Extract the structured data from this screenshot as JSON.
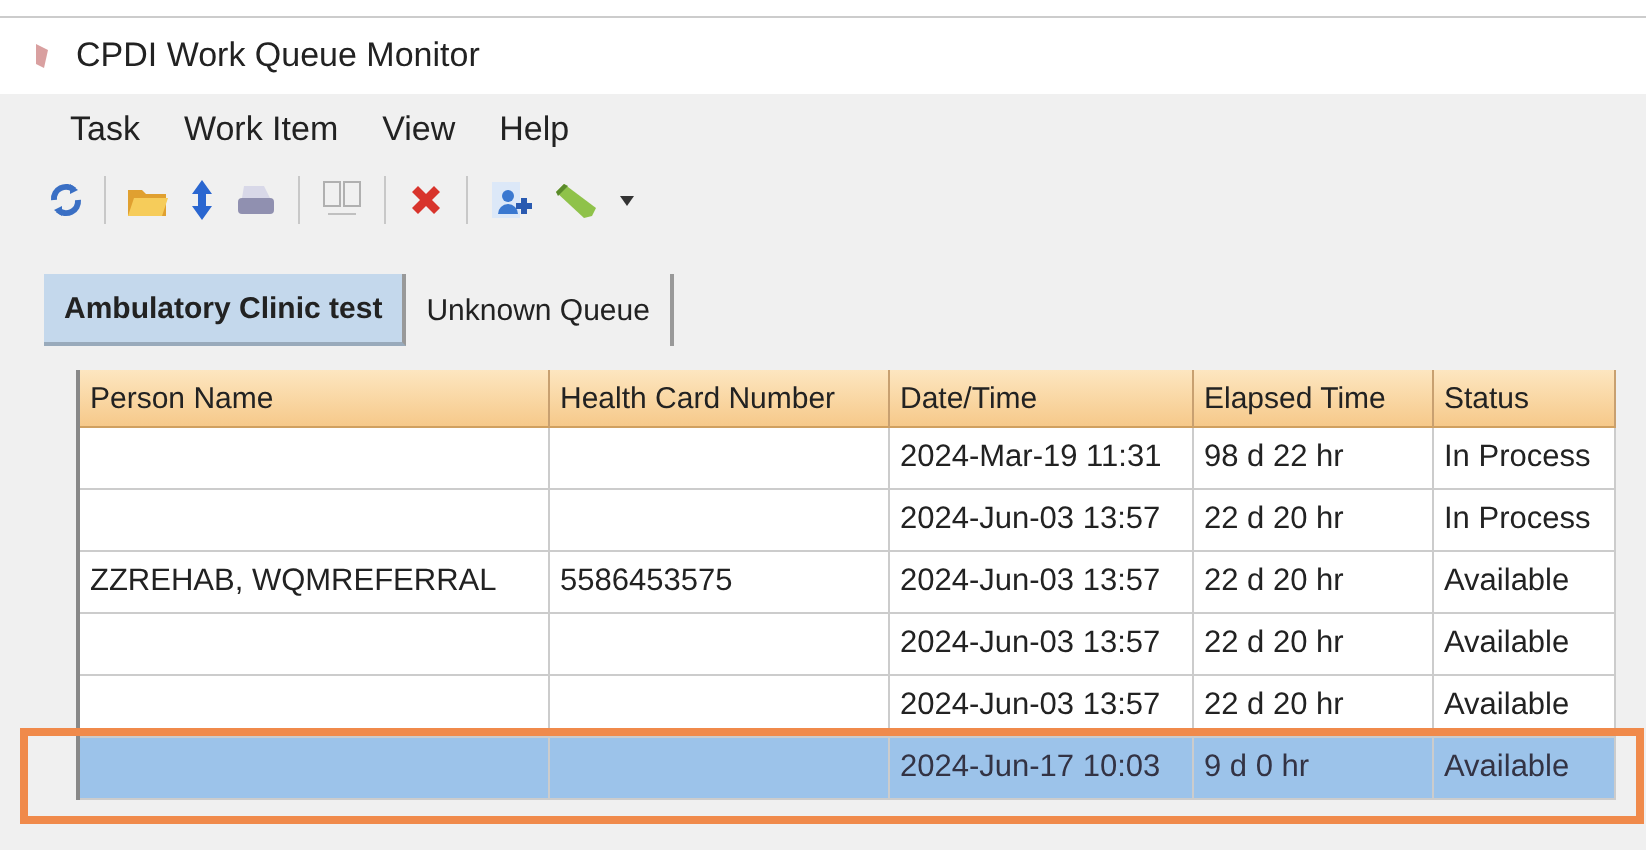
{
  "window": {
    "title": "CPDI Work Queue Monitor"
  },
  "menu": [
    "Task",
    "Work Item",
    "View",
    "Help"
  ],
  "tabs": [
    {
      "label": "Ambulatory Clinic test",
      "selected": true
    },
    {
      "label": "Unknown Queue",
      "selected": false
    }
  ],
  "table": {
    "columns": [
      "Person Name",
      "Health Card Number",
      "Date/Time",
      "Elapsed Time",
      "Status"
    ],
    "rows": [
      {
        "date_time": "2024-Mar-19 11:31",
        "elapsed_time": "98 d 22 hr",
        "status": "In Process",
        "selected": false
      },
      {
        "date_time": "2024-Jun-03 13:57",
        "elapsed_time": "22 d 20 hr",
        "status": "In Process",
        "selected": false
      },
      {
        "person_name": "ZZREHAB, WQMREFERRAL",
        "health_card_number": "5586453575",
        "date_time": "2024-Jun-03 13:57",
        "elapsed_time": "22 d 20 hr",
        "status": "Available",
        "selected": false
      },
      {
        "date_time": "2024-Jun-03 13:57",
        "elapsed_time": "22 d 20 hr",
        "status": "Available",
        "selected": false
      },
      {
        "date_time": "2024-Jun-03 13:57",
        "elapsed_time": "22 d 20 hr",
        "status": "Available",
        "selected": false
      },
      {
        "date_time": "2024-Jun-17 10:03",
        "elapsed_time": "9 d 0 hr",
        "status": "Available",
        "selected": true
      }
    ]
  }
}
